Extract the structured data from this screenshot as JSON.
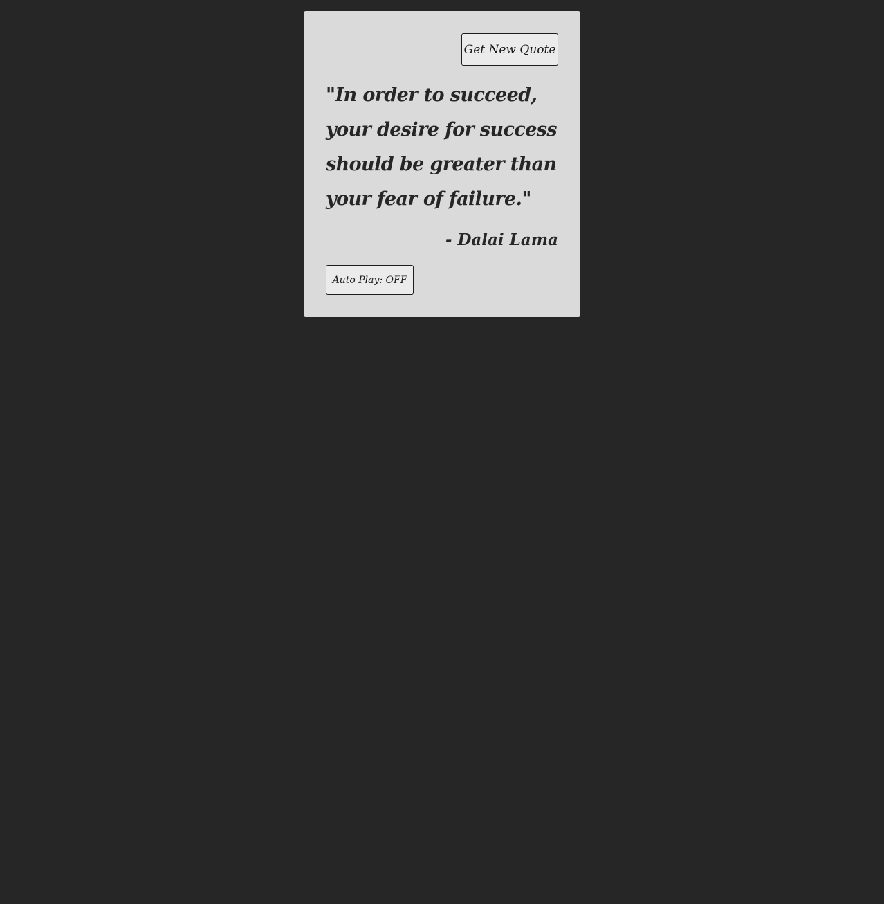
{
  "colors": {
    "page_background": "#262626",
    "card_background": "#dadada",
    "text": "#262626",
    "button_border": "#1e1e1e"
  },
  "controls": {
    "new_quote_label": "Get New Quote",
    "autoplay_label": "Auto Play: OFF"
  },
  "quote": {
    "text": "\"In order to succeed, your desire for success should be greater than your fear of failure.\"",
    "author": "- Dalai Lama"
  }
}
